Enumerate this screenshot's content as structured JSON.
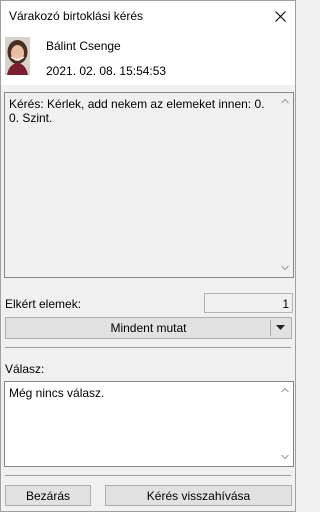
{
  "window": {
    "title": "Várakozó birtoklási kérés"
  },
  "request": {
    "author": "Bálint Csenge",
    "datetime": "2021. 02. 08. 15:54:53",
    "message": "Kérés: Kérlek, add nekem az elemeket innen: 0. 0. Szint."
  },
  "requested_items": {
    "label": "Elkért elemek:",
    "count": "1"
  },
  "show_all_button": {
    "label": "Mindent mutat"
  },
  "reply": {
    "label": "Válasz:",
    "text": "Még nincs válasz."
  },
  "buttons": {
    "close_label": "Bezárás",
    "withdraw_label": "Kérés visszahívása"
  }
}
